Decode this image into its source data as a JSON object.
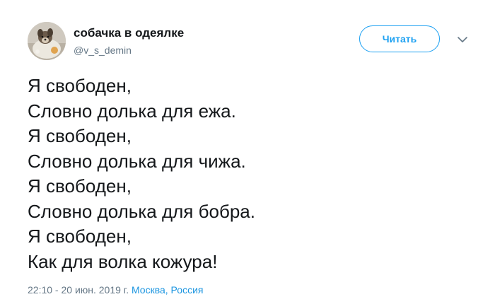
{
  "user": {
    "display_name": "собачка в одеялке",
    "handle": "@v_s_demin",
    "avatar_icon": "dog-in-blanket-avatar"
  },
  "actions": {
    "follow_label": "Читать",
    "menu_icon": "chevron-down-icon"
  },
  "tweet": {
    "lines": [
      "Я свободен,",
      "Словно долька для ежа.",
      "Я свободен,",
      "Словно долька для чижа.",
      "Я свободен,",
      "Словно долька для бобра.",
      "Я свободен,",
      "Как для волка кожура!"
    ],
    "timestamp": "22:10 - 20 июн. 2019 г.",
    "location": "Москва, Россия"
  },
  "colors": {
    "accent": "#1da1f2",
    "link": "#1b95e0",
    "text": "#14171a",
    "muted": "#657786"
  }
}
